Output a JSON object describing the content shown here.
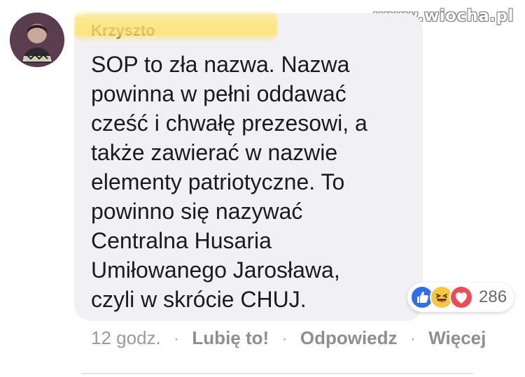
{
  "watermark": "www.wiocha.pl",
  "comment": {
    "author_visible": "Krzyszto",
    "text": "SOP to zła nazwa. Nazwa\npowinna w pełni oddawać\ncześć i chwałę prezesowi, a\ntakże zawierać w nazwie\nelementy patriotyczne. To\npowinno się nazywać\nCentralna Husaria\nUmiłowanego Jarosława,\nczyli w skrócie CHUJ.",
    "reaction_count": "286"
  },
  "actions": {
    "time": "12 godz.",
    "like": "Lubię to!",
    "reply": "Odpowiedz",
    "more": "Więcej"
  },
  "colors": {
    "bubble": "#f1f1f4",
    "like": "#2f6ef0",
    "haha": "#f7c742",
    "love": "#ef4a58",
    "muted_text": "#9b9b9b",
    "dark_text": "#1b1b1b"
  }
}
